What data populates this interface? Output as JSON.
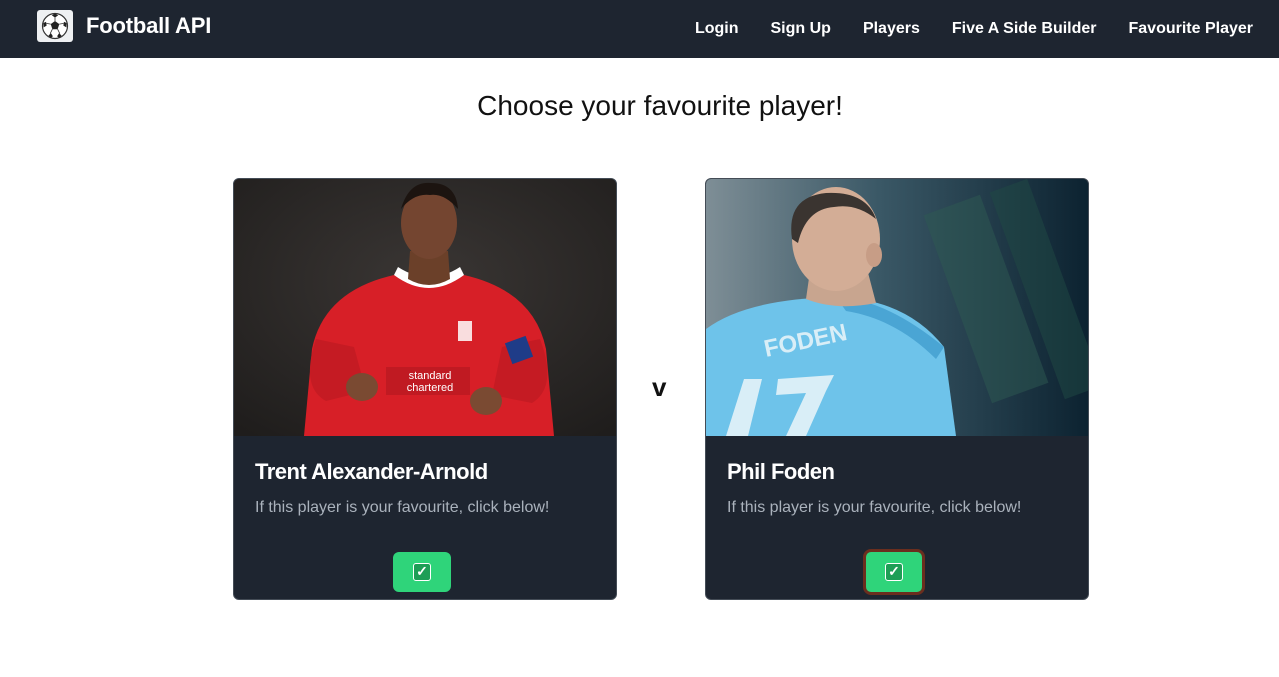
{
  "navbar": {
    "brand_name": "Football API",
    "brand_icon": "soccer-ball-icon",
    "links": [
      "Login",
      "Sign Up",
      "Players",
      "Five A Side Builder",
      "Favourite Player"
    ]
  },
  "page": {
    "title": "Choose your favourite player!",
    "versus": "v"
  },
  "players": [
    {
      "name": "Trent Alexander-Arnold",
      "prompt": "If this player is your favourite, click below!",
      "button_icon": "check-mark-icon",
      "button_glyph": "✓"
    },
    {
      "name": "Phil Foden",
      "prompt": "If this player is your favourite, click below!",
      "button_icon": "check-mark-icon",
      "button_glyph": "✓"
    }
  ],
  "colors": {
    "navbar": "#1e2530",
    "card": "#1e2530",
    "button": "#2fd47a",
    "focused_ring": "#6b2e1e"
  }
}
